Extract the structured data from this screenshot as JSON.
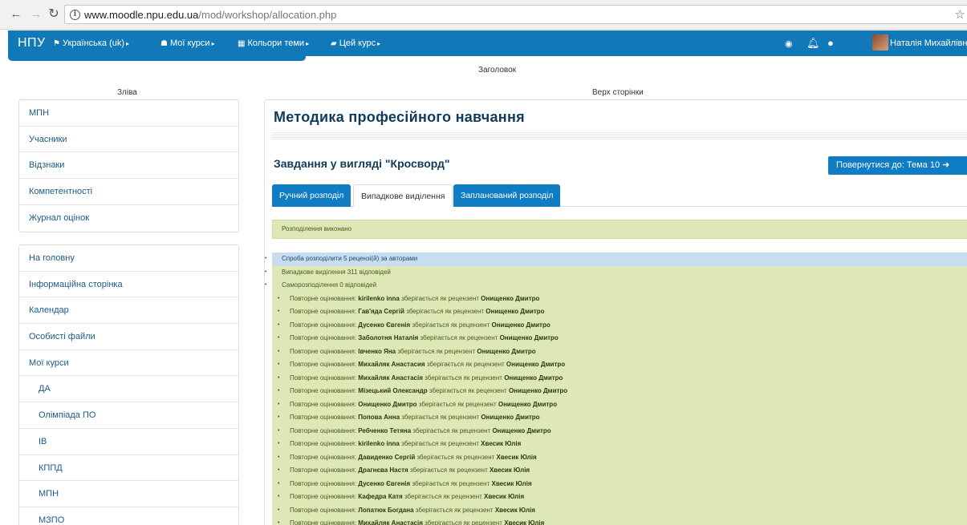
{
  "browser": {
    "url_host": "www.moodle.npu.edu.ua",
    "url_path": "/mod/workshop/allocation.php"
  },
  "navbar": {
    "brand": "НПУ",
    "items": [
      {
        "label": "Українська (uk)",
        "icon": "flag-icon"
      },
      {
        "label": "Мої курси",
        "icon": "graduation-cap-icon"
      },
      {
        "label": "Кольори теми",
        "icon": "grid-icon"
      },
      {
        "label": "Цей курс",
        "icon": "book-icon"
      }
    ],
    "user_name": "Наталія Михайлівна"
  },
  "regions": {
    "header": "Заголовок",
    "left": "Зліва",
    "top": "Верх сторінки"
  },
  "left_block1": [
    "МПН",
    "Учасники",
    "Відзнаки",
    "Компетентності",
    "Журнал оцінок"
  ],
  "left_block2": [
    {
      "label": "На головну",
      "sub": false
    },
    {
      "label": "Інформаційна сторінка",
      "sub": false
    },
    {
      "label": "Календар",
      "sub": false
    },
    {
      "label": "Особисті файли",
      "sub": false
    },
    {
      "label": "Мої курси",
      "sub": false
    },
    {
      "label": "ДА",
      "sub": true
    },
    {
      "label": "Олімпіада ПО",
      "sub": true
    },
    {
      "label": "ІВ",
      "sub": true
    },
    {
      "label": "КППД",
      "sub": true
    },
    {
      "label": "МПН",
      "sub": true
    },
    {
      "label": "МЗПО",
      "sub": true
    }
  ],
  "main": {
    "course_title": "Методика професійного навчання",
    "task_title": "Завдання у вигляді \"Кросворд\"",
    "back_button": "Повернутися до: Тема 10",
    "tabs": [
      "Ручний розподіл",
      "Випадкове виділення",
      "Запланований розподіл"
    ],
    "status": "Розподілення виконано",
    "log_top": "Спроба розподілити 5 рецензі(й) за авторами",
    "log_lines": [
      "Випадкове виділення 311 відповідей",
      "Саморозподілення 0 відповідей"
    ],
    "log_prefix": "Повторне оцінювання:",
    "log_middle": "зберігається як рецензент",
    "log_entries": [
      {
        "author": "kirilenko inna",
        "reviewer": "Онищенко Дмитро"
      },
      {
        "author": "Гав'яда Сергій",
        "reviewer": "Онищенко Дмитро"
      },
      {
        "author": "Дусенко Євгенія",
        "reviewer": "Онищенко Дмитро"
      },
      {
        "author": "Заболотня Наталія",
        "reviewer": "Онищенко Дмитро"
      },
      {
        "author": "Івченко Яна",
        "reviewer": "Онищенко Дмитро"
      },
      {
        "author": "Михайляк Анастасия",
        "reviewer": "Онищенко Дмитро"
      },
      {
        "author": "Михайляк Анастасія",
        "reviewer": "Онищенко Дмитро"
      },
      {
        "author": "Мізецький Олександр",
        "reviewer": "Онищенко Дмитро"
      },
      {
        "author": "Онищенко Дмитро",
        "reviewer": "Онищенко Дмитро"
      },
      {
        "author": "Попова Анна",
        "reviewer": "Онищенко Дмитро"
      },
      {
        "author": "Ребченко Тетяна",
        "reviewer": "Онищенко Дмитро"
      },
      {
        "author": "kirilenko inna",
        "reviewer": "Хвесик Юлія"
      },
      {
        "author": "Давиденко Сергій",
        "reviewer": "Хвесик Юлія"
      },
      {
        "author": "Драгнєва Настя",
        "reviewer": "Хвесик Юлія"
      },
      {
        "author": "Дусенко Євгенія",
        "reviewer": "Хвесик Юлія"
      },
      {
        "author": "Кафедра Катя",
        "reviewer": "Хвесик Юлія"
      },
      {
        "author": "Лопатюк Богдана",
        "reviewer": "Хвесик Юлія"
      },
      {
        "author": "Михайляк Анастасія",
        "reviewer": "Хвесик Юлія"
      }
    ]
  }
}
